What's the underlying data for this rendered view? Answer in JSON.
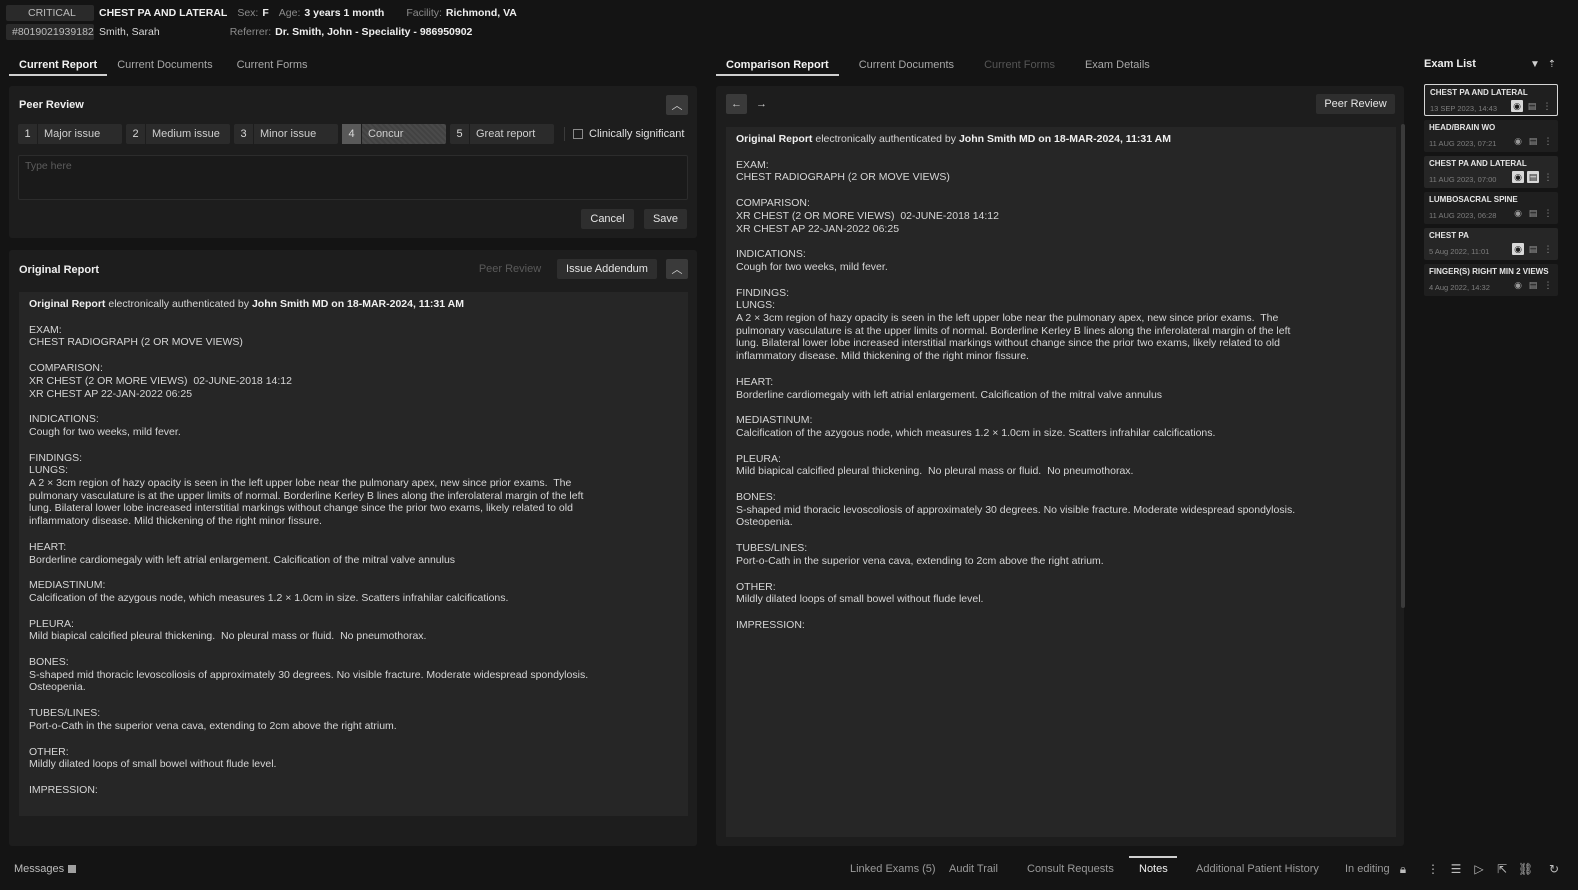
{
  "header": {
    "priority": "CRITICAL",
    "exam_title": "CHEST PA AND LATERAL",
    "sex_label": "Sex:",
    "sex_value": "F",
    "age_label": "Age:",
    "age_value": "3 years 1 month",
    "facility_label": "Facility:",
    "facility_value": "Richmond, VA",
    "accession": "#8019021939182",
    "patient_name": "Smith, Sarah",
    "referrer_label": "Referrer:",
    "referrer_value": "Dr. Smith, John - Speciality - 986950902"
  },
  "left_tabs": [
    "Current Report",
    "Current Documents",
    "Current Forms"
  ],
  "right_tabs": [
    "Comparison Report",
    "Current Documents",
    "Current Forms",
    "Exam Details"
  ],
  "peer_review": {
    "title": "Peer Review",
    "ratings": [
      {
        "num": "1",
        "label": "Major issue"
      },
      {
        "num": "2",
        "label": "Medium issue"
      },
      {
        "num": "3",
        "label": "Minor issue"
      },
      {
        "num": "4",
        "label": "Concur"
      },
      {
        "num": "5",
        "label": "Great report"
      }
    ],
    "selected_rating": "4",
    "clinically_significant": "Clinically significant",
    "placeholder": "Type here",
    "cancel": "Cancel",
    "save": "Save"
  },
  "original_report": {
    "title": "Original Report",
    "peer_review_btn": "Peer Review",
    "addendum_btn": "Issue Addendum"
  },
  "comparison": {
    "peer_review_btn": "Peer Review"
  },
  "report": {
    "auth_prefix": "Original Report",
    "auth_mid": " electronically authenticated by ",
    "auth_by": "John Smith MD on 18-MAR-2024, 11:31 AM",
    "sections": [
      {
        "h": "EXAM:",
        "t": "CHEST RADIOGRAPH (2 OR MOVE VIEWS)"
      },
      {
        "h": "COMPARISON:",
        "t": "XR CHEST (2 OR MORE VIEWS)  02-JUNE-2018 14:12\nXR CHEST AP 22-JAN-2022 06:25"
      },
      {
        "h": "INDICATIONS:",
        "t": "Cough for two weeks, mild fever."
      },
      {
        "h": "FINDINGS:\nLUNGS:",
        "t": "A 2 × 3cm region of hazy opacity is seen in the left upper lobe near the pulmonary apex, new since prior exams.  The\npulmonary vasculature is at the upper limits of normal. Borderline Kerley B lines along the inferolateral margin of the left\nlung. Bilateral lower lobe increased interstitial markings without change since the prior two exams, likely related to old\ninflammatory disease. Mild thickening of the right minor fissure."
      },
      {
        "h": "HEART:",
        "t": "Borderline cardiomegaly with left atrial enlargement. Calcification of the mitral valve annulus"
      },
      {
        "h": "MEDIASTINUM:",
        "t": "Calcification of the azygous node, which measures 1.2 × 1.0cm in size. Scatters infrahilar calcifications."
      },
      {
        "h": "PLEURA:",
        "t": "Mild biapical calcified pleural thickening.  No pleural mass or fluid.  No pneumothorax."
      },
      {
        "h": "BONES:",
        "t": "S-shaped mid thoracic levoscoliosis of approximately 30 degrees. No visible fracture. Moderate widespread spondylosis.\nOsteopenia."
      },
      {
        "h": "TUBES/LINES:",
        "t": "Port-o-Cath in the superior vena cava, extending to 2cm above the right atrium."
      },
      {
        "h": "OTHER:",
        "t": "Mildly dilated loops of small bowel without flude level."
      },
      {
        "h": "IMPRESSION:",
        "t": ""
      }
    ]
  },
  "exam_list": {
    "title": "Exam List",
    "items": [
      {
        "name": "CHEST PA AND LATERAL",
        "date": "13 SEP 2023, 14:43"
      },
      {
        "name": "HEAD/BRAIN WO",
        "date": "11 AUG 2023, 07:21"
      },
      {
        "name": "CHEST PA AND LATERAL",
        "date": "11 AUG 2023, 07:00"
      },
      {
        "name": "LUMBOSACRAL SPINE",
        "date": "11 AUG 2023, 06:28"
      },
      {
        "name": "CHEST PA",
        "date": "5 Aug 2022, 11:01"
      },
      {
        "name": "FINGER(S) RIGHT MIN 2 VIEWS",
        "date": "4 Aug 2022, 14:32"
      }
    ]
  },
  "bottom": {
    "messages": "Messages",
    "tabs": [
      "Linked Exams (5)",
      "Audit Trail",
      "Consult Requests",
      "Notes",
      "Additional Patient History",
      "In editing"
    ],
    "active_tab": "Notes"
  }
}
